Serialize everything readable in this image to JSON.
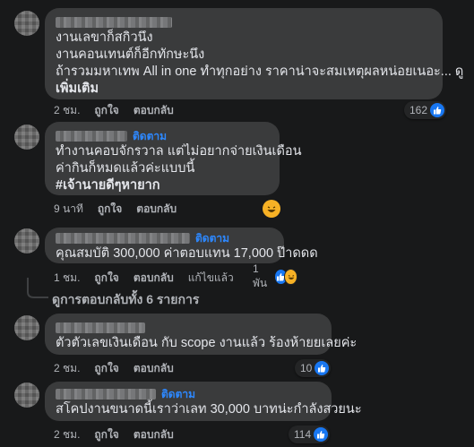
{
  "comments": [
    {
      "lines": [
        "งานเลขาก็สกิวนึง",
        "งานคอนเทนต์ก็อีกทักษะนึง",
        "ถ้ารวมมหาเทพ All in one ทำทุกอย่าง ราคาน่าจะสมเหตุผลหน่อยเนอะ... ดู"
      ],
      "see_more": "เพิ่มเติม",
      "time": "2 ชม.",
      "like": "ถูกใจ",
      "reply": "ตอบกลับ",
      "reaction_count": "162"
    },
    {
      "follow": "ติดตาม",
      "lines": [
        "ทำงานคอบจักรวาล แต่ไม่อยากจ่ายเงินเดือน",
        "ค่ากินก็หมดแล้วค่ะแบบนี้"
      ],
      "hashtag": "#เจ้านายดีๆหายาก",
      "time": "9 นาที",
      "like": "ถูกใจ",
      "reply": "ตอบกลับ"
    },
    {
      "follow": "ติดตาม",
      "lines": [
        "คุณสมบัติ 300,000 ค่าตอบแทน 17,000 ป๊าดดด"
      ],
      "time": "1 ชม.",
      "like": "ถูกใจ",
      "reply": "ตอบกลับ",
      "edited": "แก้ไขแล้ว",
      "reaction_count": "1 พัน"
    },
    {
      "lines": [
        "ตัวตัวเลขเงินเดือน กับ scope งานแล้ว ร้องห้ายยเลยค่ะ"
      ],
      "time": "2 ชม.",
      "like": "ถูกใจ",
      "reply": "ตอบกลับ",
      "reaction_count": "10"
    },
    {
      "follow": "ติดตาม",
      "lines": [
        "สโคปงานขนาดนี้เราว่าเลท 30,000 บาทน่ะกำลังสวยนะ"
      ],
      "time": "2 ชม.",
      "like": "ถูกใจ",
      "reply": "ตอบกลับ",
      "reaction_count": "114"
    }
  ],
  "view_replies": "ดูการตอบกลับทั้ง 6 รายการ",
  "colors": {
    "bg": "#18191a",
    "bubble": "#3a3b3c",
    "link": "#2d88ff",
    "like": "#1877f2",
    "meta": "#b0b3b8"
  }
}
